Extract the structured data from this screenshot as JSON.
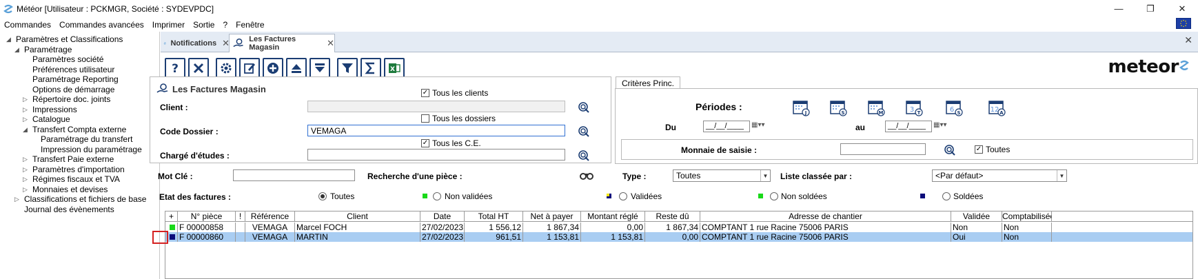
{
  "window": {
    "title": "Météor [Utilisateur : PCKMGR, Société : SYDEVPDC]"
  },
  "menu": [
    "Commandes",
    "Commandes avancées",
    "Imprimer",
    "Sortie",
    "?",
    "Fenêtre"
  ],
  "tree": [
    {
      "label": "Paramètres et Classifications",
      "level": 0,
      "toggle": "◢"
    },
    {
      "label": "Paramétrage",
      "level": 1,
      "toggle": "◢"
    },
    {
      "label": "Paramètres société",
      "level": 2,
      "toggle": ""
    },
    {
      "label": "Préférences utilisateur",
      "level": 2,
      "toggle": ""
    },
    {
      "label": "Paramétrage Reporting",
      "level": 2,
      "toggle": ""
    },
    {
      "label": "Options de démarrage",
      "level": 2,
      "toggle": ""
    },
    {
      "label": "Répertoire doc. joints",
      "level": 2,
      "toggle": "▷"
    },
    {
      "label": "Impressions",
      "level": 2,
      "toggle": "▷"
    },
    {
      "label": "Catalogue",
      "level": 2,
      "toggle": "▷"
    },
    {
      "label": "Transfert Compta externe",
      "level": 2,
      "toggle": "◢"
    },
    {
      "label": "Paramétrage du transfert",
      "level": 3,
      "toggle": ""
    },
    {
      "label": "Impression du paramétrage",
      "level": 3,
      "toggle": ""
    },
    {
      "label": "Transfert Paie externe",
      "level": 2,
      "toggle": "▷"
    },
    {
      "label": "Paramètres d'importation",
      "level": 2,
      "toggle": "▷"
    },
    {
      "label": "Régimes fiscaux et TVA",
      "level": 2,
      "toggle": "▷"
    },
    {
      "label": "Monnaies et devises",
      "level": 2,
      "toggle": "▷"
    },
    {
      "label": "Classifications et fichiers de base",
      "level": 1,
      "toggle": "▷"
    },
    {
      "label": "Journal des évènements",
      "level": 1,
      "toggle": ""
    }
  ],
  "tabs": [
    {
      "label": "Notifications",
      "active": false
    },
    {
      "label": "Les Factures Magasin",
      "active": true
    }
  ],
  "logo": {
    "text": "meteor"
  },
  "search_panel": {
    "title": "Les Factures Magasin",
    "all_clients_label": "Tous les clients",
    "client_label": "Client :",
    "client_value": "",
    "all_dossiers_label": "Tous les dossiers",
    "dossier_label": "Code Dossier :",
    "dossier_value": "VEMAGA",
    "all_ce_label": "Tous les C.E.",
    "charge_label": "Chargé d'études :",
    "charge_value": ""
  },
  "criteria": {
    "tab_label": "Critères Princ.",
    "periods_label": "Périodes :",
    "period_icons": [
      "J",
      "S",
      "M",
      "T",
      "S",
      "A"
    ],
    "period_numbers": [
      "",
      "",
      "",
      "3",
      "6",
      "12"
    ],
    "du_label": "Du",
    "au_label": "au",
    "du_value": "__/__/____",
    "au_value": "__/__/____",
    "monnaie_label": "Monnaie de saisie :",
    "monnaie_value": "",
    "toutes_label": "Toutes"
  },
  "filters": {
    "motcle_label": "Mot Clé :",
    "motcle_value": "",
    "recherche_label": "Recherche d'une pièce :",
    "type_label": "Type :",
    "type_value": "Toutes",
    "liste_label": "Liste classée par :",
    "liste_value": "<Par défaut>",
    "etat_label": "Etat des factures :",
    "etat_options": [
      {
        "label": "Toutes",
        "checked": true
      },
      {
        "label": "Non validées",
        "checked": false
      },
      {
        "label": "Validées",
        "checked": false
      },
      {
        "label": "Non soldées",
        "checked": false
      },
      {
        "label": "Soldées",
        "checked": false
      }
    ]
  },
  "colors": {
    "accent": "#1b3d73",
    "selection": "#a9cdf2",
    "green": "#19d919",
    "navy": "#0b0b7a",
    "yellow": "#f2e600"
  },
  "grid": {
    "columns": [
      "+",
      "N° pièce",
      "!",
      "Référence",
      "Client",
      "Date",
      "Total HT",
      "Net à payer",
      "Montant réglé",
      "Reste dû",
      "Adresse de chantier",
      "Validée",
      "Comptabilisée"
    ],
    "rows": [
      {
        "status": "green",
        "piece": "F 00000858",
        "excl": "",
        "ref": "VEMAGA",
        "client": "Marcel FOCH",
        "date": "27/02/2023",
        "total_ht": "1 556,12",
        "net": "1 867,34",
        "regle": "0,00",
        "reste": "1 867,34",
        "adresse": "COMPTANT 1 rue Racine  75006 PARIS",
        "validee": "Non",
        "compta": "Non",
        "selected": false
      },
      {
        "status": "navy",
        "piece": "F 00000860",
        "excl": "",
        "ref": "VEMAGA",
        "client": "MARTIN",
        "date": "27/02/2023",
        "total_ht": "961,51",
        "net": "1 153,81",
        "regle": "1 153,81",
        "reste": "0,00",
        "adresse": "COMPTANT 1 rue Racine  75006 PARIS",
        "validee": "Oui",
        "compta": "Non",
        "selected": true
      }
    ]
  }
}
